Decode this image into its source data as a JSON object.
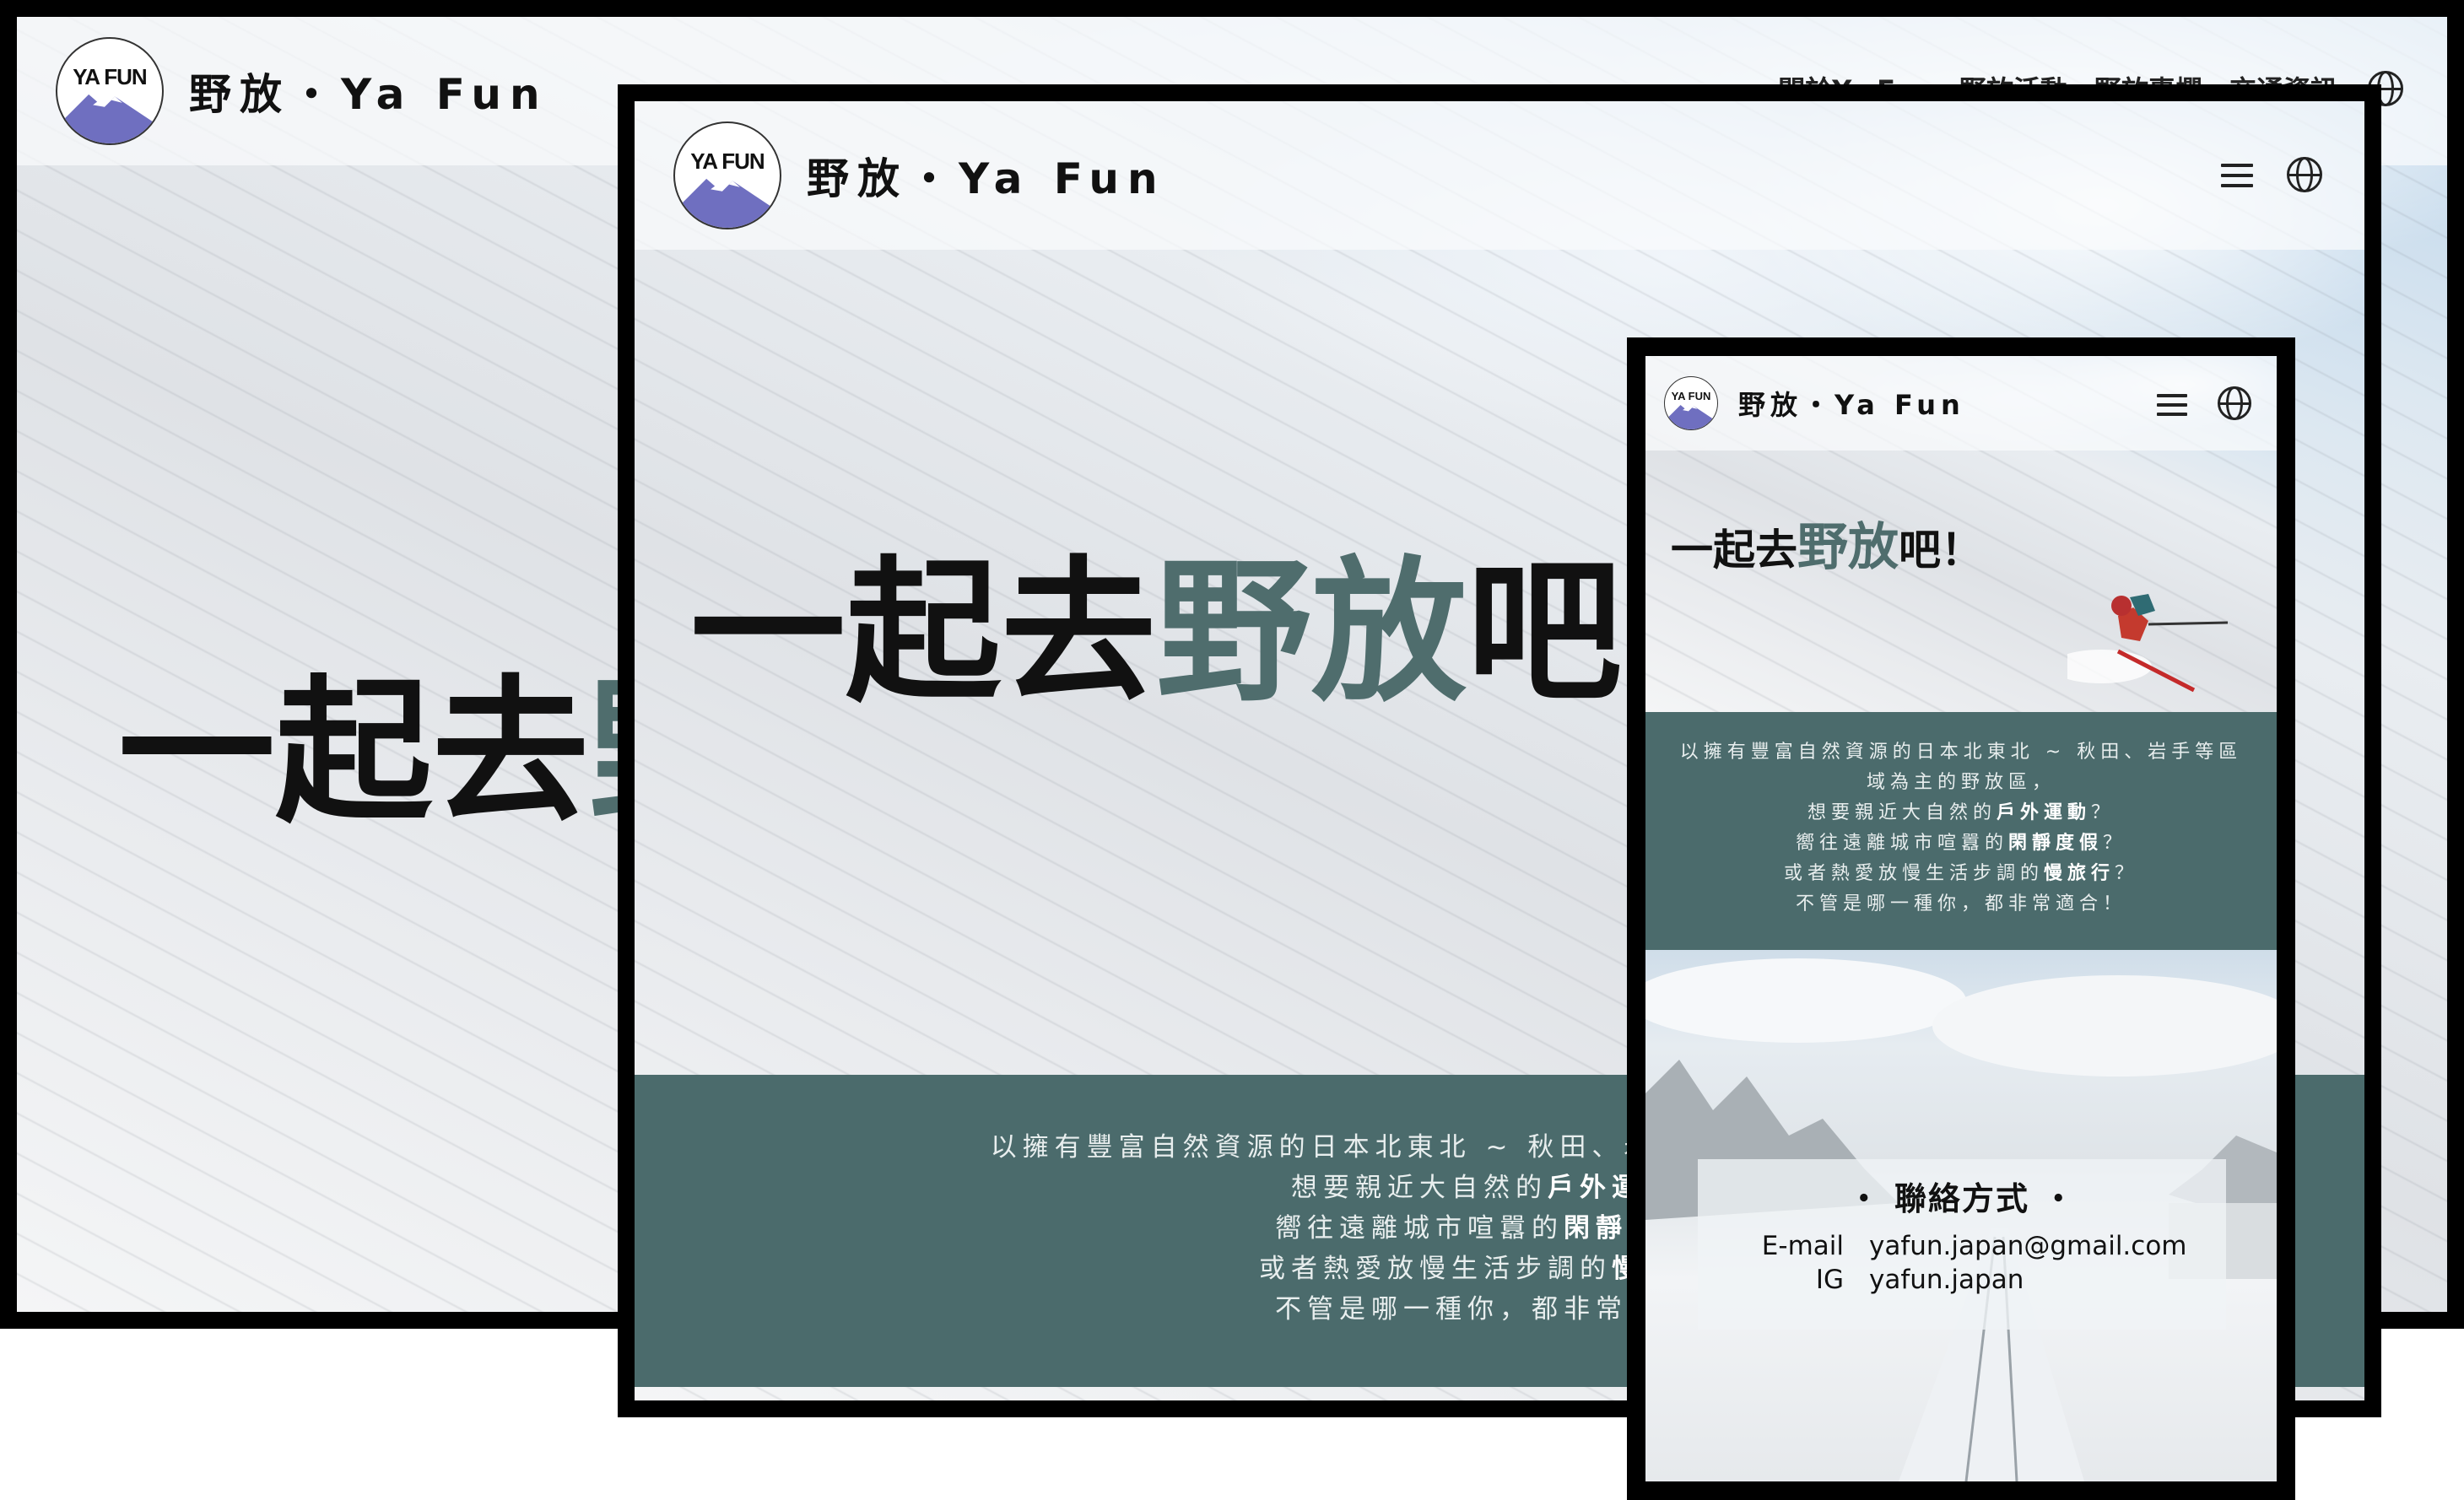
{
  "brand": {
    "name": "野放・Ya Fun",
    "logo_text": "YA FUN"
  },
  "nav": {
    "items": [
      "關於Ya Fun",
      "野放活動",
      "野放專欄",
      "交通資訊"
    ]
  },
  "hero": {
    "pre": "一起去",
    "accent": "野放",
    "post": "吧！"
  },
  "intro": {
    "line1": "以擁有豐富自然資源的日本北東北 ~ 秋田、岩手等區域為主的野放區，",
    "line2_pre": "想要親近大自然的",
    "line2_hl": "戶外運動",
    "line2_post": "？",
    "line3_pre": "嚮往遠離城市喧囂的",
    "line3_hl": "閑靜度假",
    "line3_post": "？",
    "line4_pre": "或者熱愛放慢生活步調的",
    "line4_hl": "慢旅行",
    "line4_post": "？",
    "line5": "不管是哪一種你，都非常適合！"
  },
  "contact": {
    "title": "・ 聯絡方式 ・",
    "email_label": "E-mail",
    "email_value": "yafun.japan@gmail.com",
    "ig_label": "IG",
    "ig_value": "yafun.japan"
  },
  "colors": {
    "accent": "#4f6d6d",
    "band": "#4b6b6c",
    "frame": "#000000"
  },
  "icons": [
    "menu-icon",
    "globe-icon",
    "logo-mountain-icon"
  ]
}
